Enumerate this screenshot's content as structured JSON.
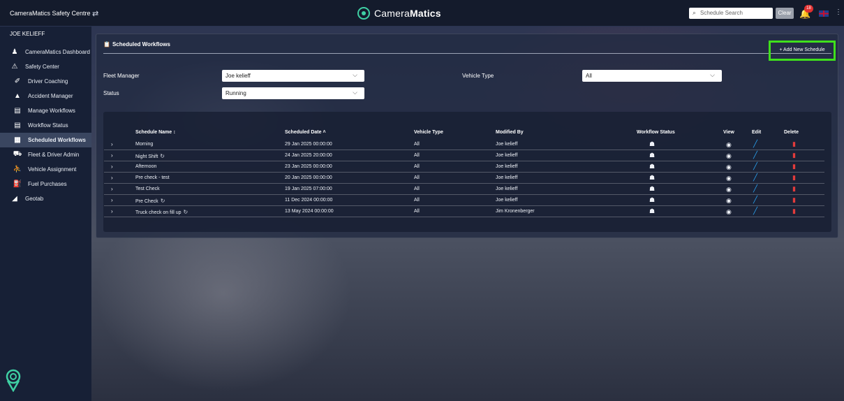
{
  "header": {
    "app_title": "CameraMatics Safety Centre",
    "swap_icon": "swap-arrows-icon",
    "logo_prefix": "Camera",
    "logo_bold": "Matics",
    "search_placeholder": "Schedule Search",
    "clear_label": "Clear",
    "alert_count": "18",
    "language_flag": "uk-flag-icon"
  },
  "sidebar": {
    "user": "JOE KELIEFF",
    "items": [
      {
        "label": "CameraMatics Dashboard",
        "icon": "user-pin-icon",
        "level": 0,
        "active": false
      },
      {
        "label": "Safety Center",
        "icon": "warning-outline-icon",
        "level": 0,
        "active": false
      },
      {
        "label": "Driver Coaching",
        "icon": "steering-icon",
        "level": 1,
        "active": false
      },
      {
        "label": "Accident Manager",
        "icon": "warning-icon",
        "level": 1,
        "active": false
      },
      {
        "label": "Manage Workflows",
        "icon": "clipboard-icon",
        "level": 1,
        "active": false
      },
      {
        "label": "Workflow Status",
        "icon": "clipboard-icon",
        "level": 1,
        "active": false
      },
      {
        "label": "Scheduled Workflows",
        "icon": "calendar-doc-icon",
        "level": 1,
        "active": true
      },
      {
        "label": "Fleet & Driver Admin",
        "icon": "car-icon",
        "level": 1,
        "active": false
      },
      {
        "label": "Vehicle Assignment",
        "icon": "person-car-icon",
        "level": 1,
        "active": false
      },
      {
        "label": "Fuel Purchases",
        "icon": "fuel-icon",
        "level": 1,
        "active": false
      },
      {
        "label": "Geotab",
        "icon": "geotab-icon",
        "level": 0,
        "active": false
      }
    ]
  },
  "page": {
    "title": "Scheduled Workflows",
    "filters": {
      "fleet_manager_label": "Fleet Manager",
      "fleet_manager_value": "Joe kelieff",
      "vehicle_type_label": "Vehicle Type",
      "vehicle_type_value": "All",
      "status_label": "Status",
      "status_value": "Running"
    },
    "add_button": "+ Add New Schedule",
    "columns": {
      "name": "Schedule Name ↕",
      "date": "Scheduled Date ˄",
      "vehicle_type": "Vehicle Type",
      "modified_by": "Modified By",
      "workflow_status": "Workflow Status",
      "view": "View",
      "edit": "Edit",
      "delete": "Delete"
    },
    "rows": [
      {
        "name": "Morning",
        "recurring": false,
        "date": "29 Jan 2025 00:00:00",
        "vehicle_type": "All",
        "modified_by": "Joe kelieff"
      },
      {
        "name": "Night Shift",
        "recurring": true,
        "date": "24 Jan 2025 20:00:00",
        "vehicle_type": "All",
        "modified_by": "Joe kelieff"
      },
      {
        "name": "Afternoon",
        "recurring": false,
        "date": "23 Jan 2025 00:00:00",
        "vehicle_type": "All",
        "modified_by": "Joe kelieff"
      },
      {
        "name": "Pre check - test",
        "recurring": false,
        "date": "20 Jan 2025 00:00:00",
        "vehicle_type": "All",
        "modified_by": "Joe kelieff"
      },
      {
        "name": "Test Check",
        "recurring": false,
        "date": "19 Jan 2025 07:00:00",
        "vehicle_type": "All",
        "modified_by": "Joe kelieff"
      },
      {
        "name": "Pre Check",
        "recurring": true,
        "date": "11 Dec 2024 00:00:00",
        "vehicle_type": "All",
        "modified_by": "Joe kelieff"
      },
      {
        "name": "Truck check on fill up",
        "recurring": true,
        "date": "13 May 2024 00:00:00",
        "vehicle_type": "All",
        "modified_by": "Jim Kronenberger"
      }
    ]
  },
  "colors": {
    "accent_green": "#3fe01c",
    "brand_teal": "#3fd0a4",
    "edit_blue": "#2aa4f4",
    "delete_red": "#e23b3b"
  }
}
